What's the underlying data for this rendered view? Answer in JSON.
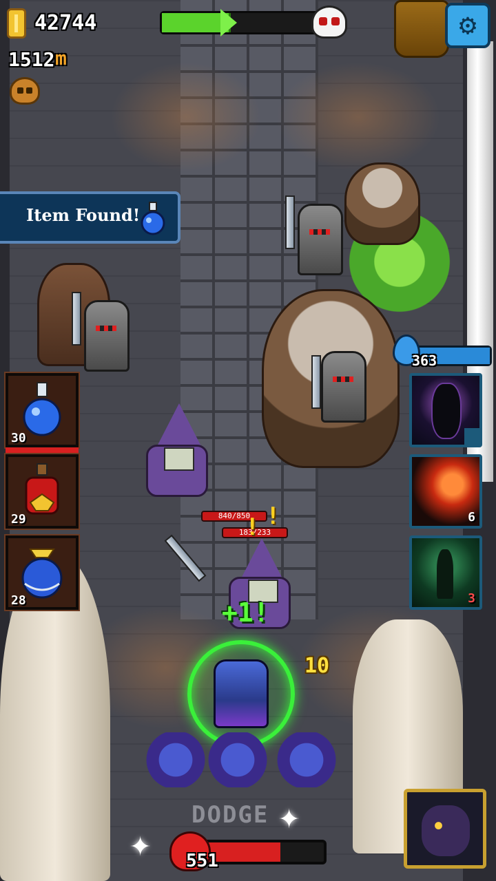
{
  "hud": {
    "gold": "42744",
    "distance": "1512",
    "distance_unit": "m",
    "level_progress": 0.42
  },
  "banner": {
    "label": "Item Found!"
  },
  "potions": [
    {
      "name": "blue-potion-icon",
      "count": "30"
    },
    {
      "name": "red-potion-icon",
      "count": "29"
    },
    {
      "name": "blue-sack-potion-icon",
      "count": "28"
    }
  ],
  "mana": {
    "value": "363"
  },
  "skills": [
    {
      "name": "dark-vortex-skill-icon",
      "count": ""
    },
    {
      "name": "fireball-skill-icon",
      "count": "6"
    },
    {
      "name": "shadow-figure-skill-icon",
      "count": "3"
    }
  ],
  "combat": {
    "enemy_hp_1": "840/850",
    "enemy_hp_2": "183/233",
    "damage": "10",
    "heal": "+1!",
    "dodge": "DODGE"
  },
  "player": {
    "hp": "551",
    "hp_fraction": 0.65
  },
  "colors": {
    "progress": "#5bd32c",
    "mana": "#2a8ad8",
    "hp": "#d82020"
  }
}
